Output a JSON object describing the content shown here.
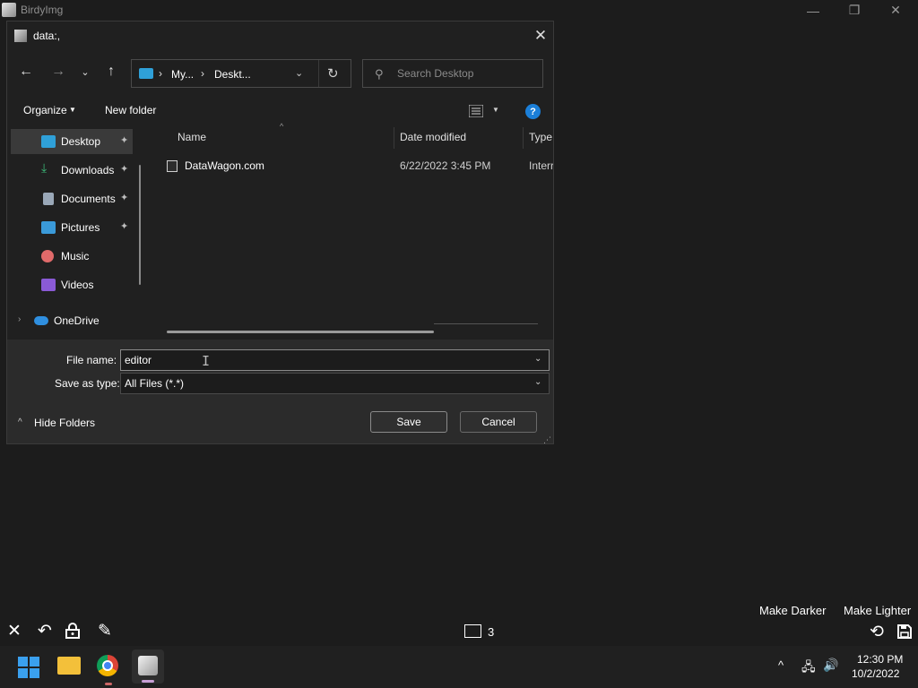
{
  "app": {
    "title": "BirdyImg",
    "minimize": "—",
    "maximize": "❐",
    "close": "✕"
  },
  "dialog": {
    "title": "data:,",
    "nav": {
      "back": "←",
      "forward": "→",
      "recent": "⌄",
      "up": "↑"
    },
    "address": {
      "crumbs": [
        "My...",
        "Deskt..."
      ],
      "separator": "›",
      "dropdown": "⌄",
      "refresh": "↻"
    },
    "search": {
      "placeholder": "Search Desktop"
    },
    "commands": {
      "organize": "Organize",
      "new_folder": "New folder",
      "help": "?"
    },
    "nav_pane": [
      {
        "label": "Desktop",
        "icon": "desktop-icon",
        "pinned": true,
        "color": "#2fa0d8"
      },
      {
        "label": "Downloads",
        "icon": "downloads-icon",
        "pinned": true,
        "color": "#3cb878"
      },
      {
        "label": "Documents",
        "icon": "documents-icon",
        "pinned": true,
        "color": "#9aa8b8"
      },
      {
        "label": "Pictures",
        "icon": "pictures-icon",
        "pinned": true,
        "color": "#3a9ad9"
      },
      {
        "label": "Music",
        "icon": "music-icon",
        "pinned": false,
        "color": "#e06a6a"
      },
      {
        "label": "Videos",
        "icon": "videos-icon",
        "pinned": false,
        "color": "#8a5ad6"
      },
      {
        "label": "OneDrive",
        "icon": "onedrive-icon",
        "pinned": false,
        "color": "#2f8fe0"
      }
    ],
    "pin_glyph": "📌",
    "columns": {
      "name": "Name",
      "date": "Date modified",
      "type": "Type"
    },
    "files": [
      {
        "name": "DataWagon.com",
        "date": "6/22/2022 3:45 PM",
        "type": "Interr"
      }
    ],
    "file_name_label": "File name:",
    "file_name_value": "editor",
    "save_type_label": "Save as type:",
    "save_type_value": "All Files (*.*)",
    "hide_folders": "Hide Folders",
    "save": "Save",
    "cancel": "Cancel"
  },
  "toolbar": {
    "close": "✕",
    "undo": "↶",
    "lock": "🔒",
    "pen": "✎",
    "page_count": "3",
    "darker": "Make Darker",
    "lighter": "Make Lighter",
    "rotate": "⟲",
    "save": "💾"
  },
  "taskbar": {
    "time": "12:30 PM",
    "date": "10/2/2022",
    "tray_chevron": "^",
    "network": "🖧",
    "volume": "🔊"
  },
  "colors": {
    "accent": "#1b7fd8",
    "background": "#1c1c1c",
    "dialog": "#202020"
  }
}
